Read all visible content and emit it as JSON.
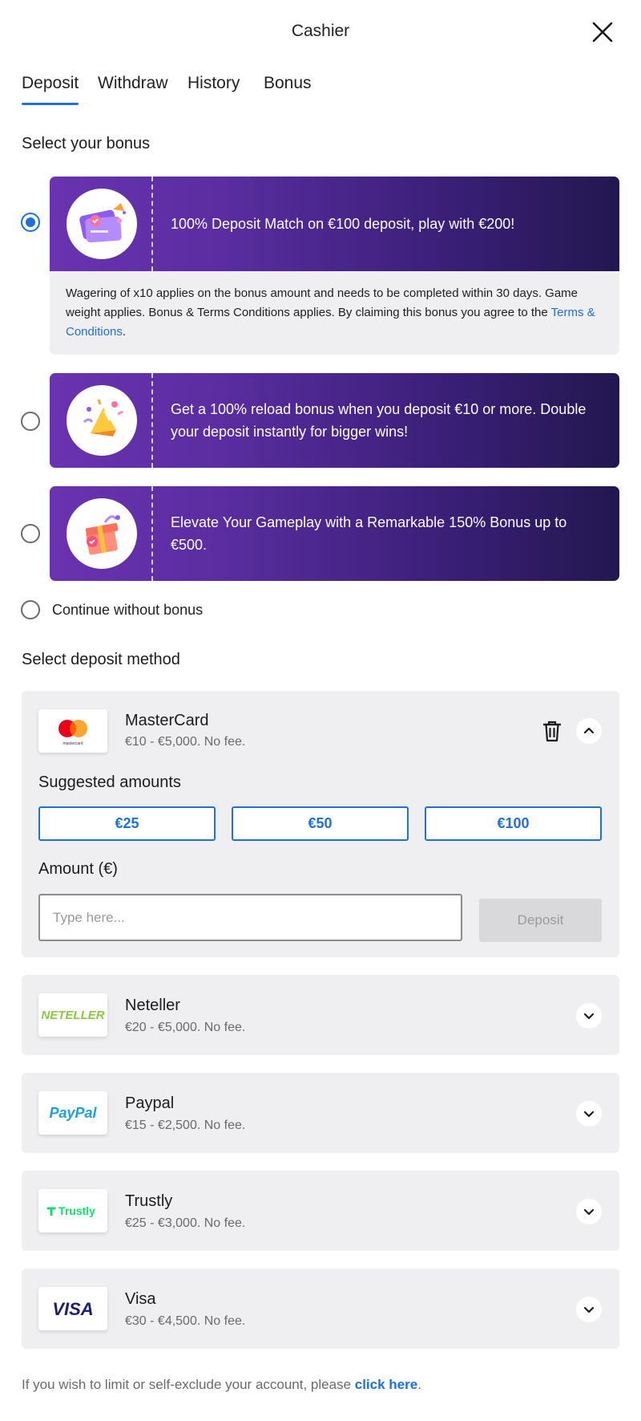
{
  "header": {
    "title": "Cashier"
  },
  "tabs": [
    {
      "label": "Deposit",
      "active": true
    },
    {
      "label": "Withdraw",
      "active": false
    },
    {
      "label": "History",
      "active": false
    },
    {
      "label": "Bonus",
      "active": false
    }
  ],
  "bonus_section": {
    "title": "Select your bonus",
    "offers": [
      {
        "text": "100% Deposit Match on €100 deposit, play with €200!",
        "selected": true,
        "details_text": "Wagering of x10 applies on the bonus amount and needs to be completed within 30 days. Game weight applies. Bonus & Terms Conditions applies. By claiming this bonus you agree to the ",
        "details_link": "Terms & Conditions",
        "details_end": "."
      },
      {
        "text": "Get a 100% reload bonus when you deposit €10 or more. Double your deposit instantly for bigger wins!",
        "selected": false
      },
      {
        "text": "Elevate Your Gameplay with a Remarkable 150% Bonus up to €500.",
        "selected": false
      }
    ],
    "no_bonus_label": "Continue without bonus"
  },
  "deposit_section": {
    "title": "Select deposit method",
    "methods": [
      {
        "name": "MasterCard",
        "range": "€10 - €5,000. No fee.",
        "expanded": true,
        "logo_text": "mastercard"
      },
      {
        "name": "Neteller",
        "range": "€20 - €5,000. No fee.",
        "expanded": false,
        "logo_text": "NETELLER"
      },
      {
        "name": "Paypal",
        "range": "€15 - €2,500. No fee.",
        "expanded": false,
        "logo_text": "PayPal"
      },
      {
        "name": "Trustly",
        "range": "€25 - €3,000. No fee.",
        "expanded": false,
        "logo_text": "Trustly"
      },
      {
        "name": "Visa",
        "range": "€30 - €4,500. No fee.",
        "expanded": false,
        "logo_text": "VISA"
      }
    ],
    "suggested_title": "Suggested amounts",
    "suggested_amounts": [
      "€25",
      "€50",
      "€100"
    ],
    "amount_label": "Amount (€)",
    "amount_placeholder": "Type here...",
    "deposit_button": "Deposit"
  },
  "footer": {
    "text": "If you wish to limit or self-exclude your account, please ",
    "link": "click here",
    "end": "."
  },
  "colors": {
    "accent": "#1f6fdc",
    "banner_start": "#6a33b0",
    "banner_end": "#23174f",
    "card_bg": "#efeff1",
    "neteller_green": "#8dc63f",
    "paypal_blue": "#1da0db",
    "trustly_green": "#0ee06e",
    "visa_navy": "#1a1f71"
  }
}
